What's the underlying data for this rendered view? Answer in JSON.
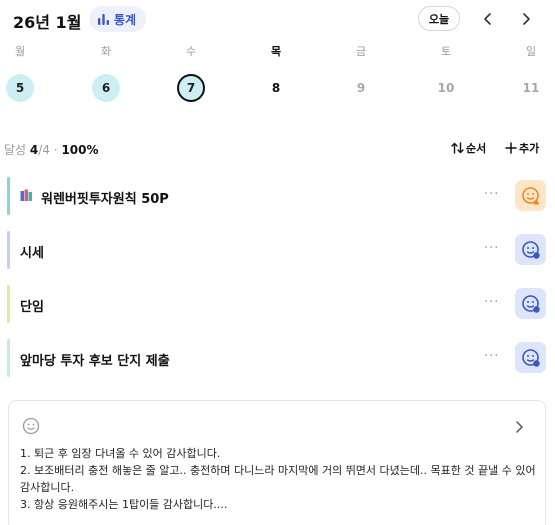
{
  "header": {
    "month_label": "26년 1월",
    "stats_label": "통계",
    "today_label": "오늘"
  },
  "week": {
    "days": [
      {
        "dow": "월",
        "num": "5",
        "state": "done"
      },
      {
        "dow": "화",
        "num": "6",
        "state": "done"
      },
      {
        "dow": "수",
        "num": "7",
        "state": "selected"
      },
      {
        "dow": "목",
        "num": "8",
        "state": "plain"
      },
      {
        "dow": "금",
        "num": "9",
        "state": "future"
      },
      {
        "dow": "토",
        "num": "10",
        "state": "future"
      },
      {
        "dow": "일",
        "num": "11",
        "state": "future"
      }
    ]
  },
  "summary": {
    "label": "달성",
    "done": "4",
    "total": "/4",
    "separator": "·",
    "percent": "100%",
    "sort_label": "순서",
    "add_label": "추가"
  },
  "tasks": [
    {
      "title": "워렌버핏투자원칙 50P",
      "more": "···",
      "status": "warn",
      "bar_color": "#7fd8dc",
      "icon": "books-icon"
    },
    {
      "title": "시세",
      "more": "···",
      "status": "ok",
      "bar_color": "#c5d0f0"
    },
    {
      "title": "단임",
      "more": "···",
      "status": "ok",
      "bar_color": "#d8ed9e"
    },
    {
      "title": "앞마당 투자 후보 단지 제출",
      "more": "···",
      "status": "ok",
      "bar_color": "#bfeef0"
    }
  ],
  "memo": {
    "lines": [
      "1. 퇴근 후 임장 다녀올 수 있어 감사합니다.",
      "2. 보조배터리 충전 해놓은 줄 알고.. 충전하며 다니느라 마지막에 거의 뛰면서 다녔는데.. 목표한 것 끝낼 수 있어 감사합니다.",
      "3. 항상 응원해주시는 1탑이들 감사합니다...."
    ]
  },
  "colors": {
    "accent": "#3a57c6",
    "done_day": "#cdeef3",
    "warn_bg": "#ffe6c9",
    "warn_fg": "#f08a1a",
    "ok_bg": "#dde5fb",
    "ok_fg": "#3a57c6"
  }
}
